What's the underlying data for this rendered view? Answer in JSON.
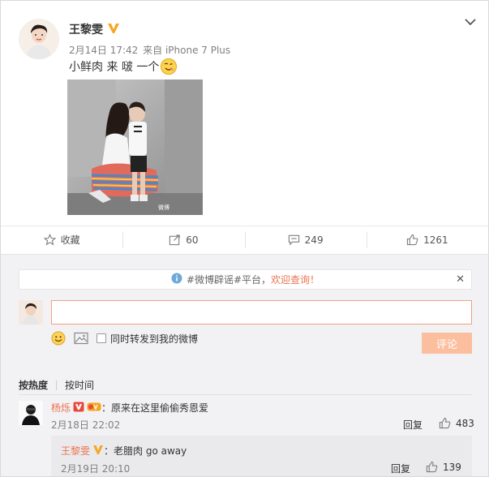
{
  "post": {
    "author": "王黎雯",
    "date": "2月14日 17:42",
    "source": "来自 iPhone 7 Plus",
    "text": "小鲜肉 来 啵 一个",
    "colors": {
      "accent": "#eb7350",
      "vbadge": "#f7a623"
    }
  },
  "actions": {
    "favorite": "收藏",
    "repost": "60",
    "comment": "249",
    "like": "1261"
  },
  "comment_box": {
    "notice_prefix": "#微博辟谣#平台，",
    "notice_highlight": "欢迎查询！",
    "checkbox_label": "同时转发到我的微博",
    "submit": "评论",
    "input_value": ""
  },
  "sort": {
    "hot": "按热度",
    "time": "按时间"
  },
  "comments": [
    {
      "user": "杨烁",
      "text": "：原来在这里偷偷秀恩爱",
      "time": "2月18日 22:02",
      "reply": "回复",
      "likes": "483",
      "replies": [
        {
          "user": "王黎雯",
          "text": "：老腊肉 go away",
          "time": "2月19日 20:10",
          "reply": "回复",
          "likes": "139"
        }
      ]
    }
  ]
}
